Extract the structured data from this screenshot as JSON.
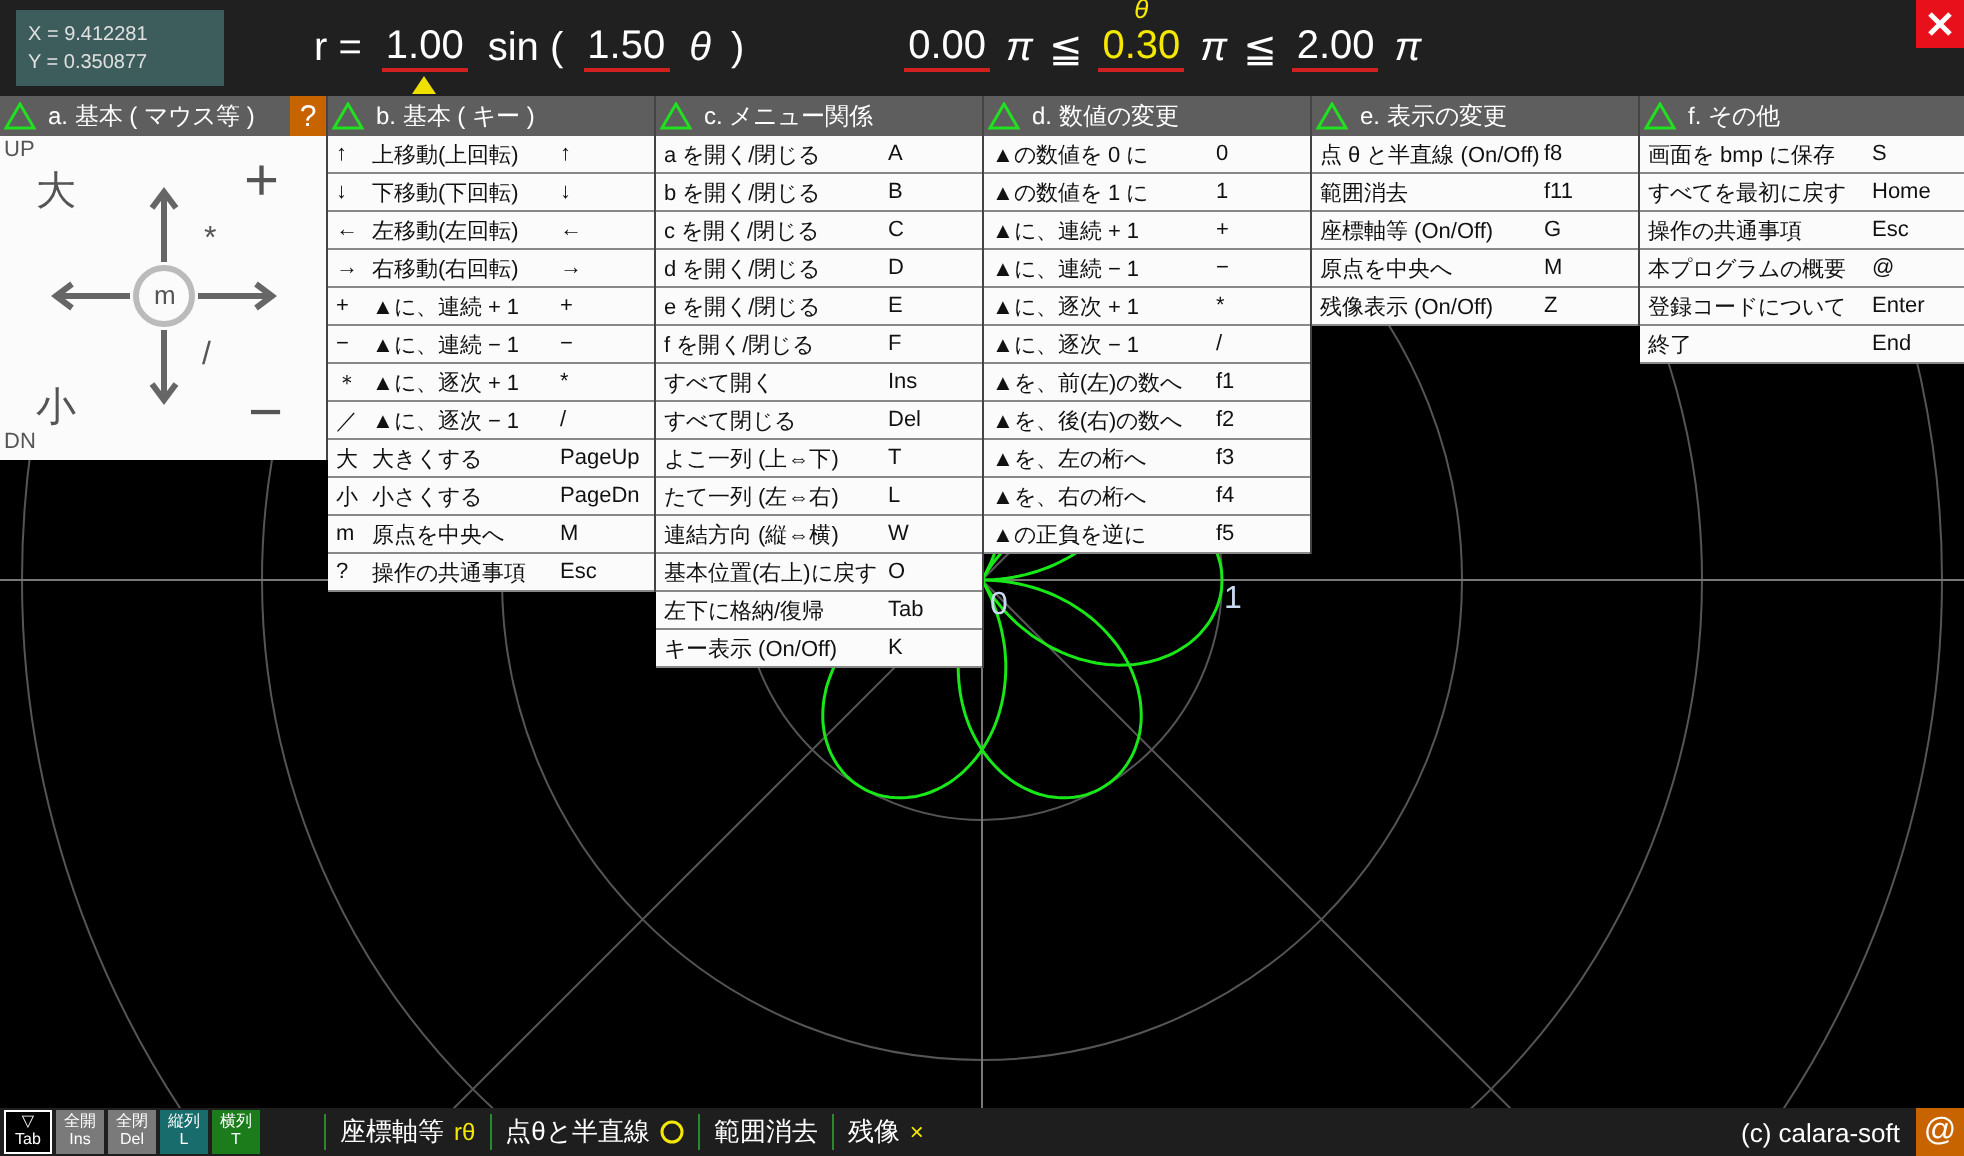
{
  "cursor": {
    "x": "X = 9.412281",
    "y": "Y = 0.350877"
  },
  "formula": [
    {
      "kind": "text",
      "text": "r ="
    },
    {
      "kind": "param",
      "value": "1.00",
      "selected": true
    },
    {
      "kind": "text",
      "text": "sin ("
    },
    {
      "kind": "param",
      "value": "1.50",
      "selected": false
    },
    {
      "kind": "italic",
      "text": "θ"
    },
    {
      "kind": "text",
      "text": ")"
    }
  ],
  "range": [
    {
      "kind": "param",
      "value": "0.00",
      "selected": false
    },
    {
      "kind": "italic",
      "text": "π"
    },
    {
      "kind": "text",
      "text": "≦"
    },
    {
      "kind": "current",
      "value": "0.30",
      "label": "θ"
    },
    {
      "kind": "italic",
      "text": "π"
    },
    {
      "kind": "text",
      "text": "≦"
    },
    {
      "kind": "param",
      "value": "2.00",
      "selected": false
    },
    {
      "kind": "italic",
      "text": "π"
    }
  ],
  "plot": {
    "origin_label": "0",
    "unit_label": "1"
  },
  "panels": [
    {
      "kind": "mouse",
      "title": "a. 基本 ( マウス等 )",
      "help": "?",
      "labels": {
        "up": "UP",
        "down": "DN",
        "larger": "大",
        "smaller": "小",
        "plus": "+",
        "minus": "−",
        "times": "*",
        "divide": "/",
        "center": "m"
      }
    },
    {
      "kind": "keys",
      "title": "b. 基本 ( キー )",
      "rows": [
        {
          "mark": "↑",
          "label": "上移動(上回転)",
          "key": "↑"
        },
        {
          "mark": "↓",
          "label": "下移動(下回転)",
          "key": "↓"
        },
        {
          "mark": "←",
          "label": "左移動(左回転)",
          "key": "←"
        },
        {
          "mark": "→",
          "label": "右移動(右回転)",
          "key": "→"
        },
        {
          "mark": "+",
          "label": "▲に、連続 + 1",
          "key": "+"
        },
        {
          "mark": "−",
          "label": "▲に、連続 − 1",
          "key": "−"
        },
        {
          "mark": "＊",
          "label": "▲に、逐次 + 1",
          "key": "*"
        },
        {
          "mark": "／",
          "label": "▲に、逐次 − 1",
          "key": "/"
        },
        {
          "mark": "大",
          "label": "大きくする",
          "key": "PageUp"
        },
        {
          "mark": "小",
          "label": "小さくする",
          "key": "PageDn"
        },
        {
          "mark": "m",
          "label": "原点を中央へ",
          "key": "M"
        },
        {
          "mark": "?",
          "label": "操作の共通事項",
          "key": "Esc"
        }
      ]
    },
    {
      "kind": "keys",
      "title": "c. メニュー関係",
      "rows": [
        {
          "label": "a を開く/閉じる",
          "key": "A"
        },
        {
          "label": "b を開く/閉じる",
          "key": "B"
        },
        {
          "label": "c を開く/閉じる",
          "key": "C"
        },
        {
          "label": "d を開く/閉じる",
          "key": "D"
        },
        {
          "label": "e を開く/閉じる",
          "key": "E"
        },
        {
          "label": "f を開く/閉じる",
          "key": "F"
        },
        {
          "label": "すべて開く",
          "key": "Ins"
        },
        {
          "label": "すべて閉じる",
          "key": "Del"
        },
        {
          "label": "よこ一列 (上⇔下)",
          "key": "T"
        },
        {
          "label": "たて一列 (左⇔右)",
          "key": "L"
        },
        {
          "label": "連結方向 (縦⇔横)",
          "key": "W"
        },
        {
          "label": "基本位置(右上)に戻す",
          "key": "O"
        },
        {
          "label": "左下に格納/復帰",
          "key": "Tab"
        },
        {
          "label": "キー表示 (On/Off)",
          "key": "K"
        }
      ]
    },
    {
      "kind": "keys",
      "title": "d. 数値の変更",
      "rows": [
        {
          "label": "▲の数値を 0 に",
          "key": "0"
        },
        {
          "label": "▲の数値を 1 に",
          "key": "1"
        },
        {
          "label": "▲に、連続 + 1",
          "key": "+"
        },
        {
          "label": "▲に、連続 − 1",
          "key": "−"
        },
        {
          "label": "▲に、逐次 + 1",
          "key": "*"
        },
        {
          "label": "▲に、逐次 − 1",
          "key": "/"
        },
        {
          "label": "▲を、前(左)の数へ",
          "key": "f1"
        },
        {
          "label": "▲を、後(右)の数へ",
          "key": "f2"
        },
        {
          "label": "▲を、左の桁へ",
          "key": "f3"
        },
        {
          "label": "▲を、右の桁へ",
          "key": "f4"
        },
        {
          "label": "▲の正負を逆に",
          "key": "f5"
        }
      ]
    },
    {
      "kind": "keys",
      "title": "e. 表示の変更",
      "rows": [
        {
          "label": "点 θ と半直線 (On/Off)",
          "key": "f8"
        },
        {
          "label": "範囲消去",
          "key": "f11"
        },
        {
          "label": "座標軸等 (On/Off)",
          "key": "G"
        },
        {
          "label": "原点を中央へ",
          "key": "M"
        },
        {
          "label": "残像表示 (On/Off)",
          "key": "Z"
        }
      ]
    },
    {
      "kind": "keys",
      "title": "f. その他",
      "rows": [
        {
          "label": "画面を bmp に保存",
          "key": "S"
        },
        {
          "label": "すべてを最初に戻す",
          "key": "Home"
        },
        {
          "label": "操作の共通事項",
          "key": "Esc"
        },
        {
          "label": "本プログラムの概要",
          "key": "@"
        },
        {
          "label": "登録コードについて",
          "key": "Enter"
        },
        {
          "label": "終了",
          "key": "End"
        }
      ]
    }
  ],
  "bottom_buttons": [
    {
      "text": "▽",
      "key": "Tab",
      "color": "#000000"
    },
    {
      "text": "全開",
      "key": "Ins",
      "color": "#7a7a7a"
    },
    {
      "text": "全閉",
      "key": "Del",
      "color": "#7a7a7a"
    },
    {
      "text": "縦列",
      "key": "L",
      "color": "#186c6c"
    },
    {
      "text": "横列",
      "key": "T",
      "color": "#1c7c1c"
    }
  ],
  "toggles": [
    {
      "label": "座標軸等",
      "kind": "text",
      "indicator": "rθ"
    },
    {
      "label": "点θと半直線",
      "kind": "circle"
    },
    {
      "label": "範囲消去",
      "kind": "none"
    },
    {
      "label": "残像",
      "kind": "text",
      "indicator": "×"
    }
  ],
  "copyright": "(c) calara-soft",
  "about_button": "@"
}
